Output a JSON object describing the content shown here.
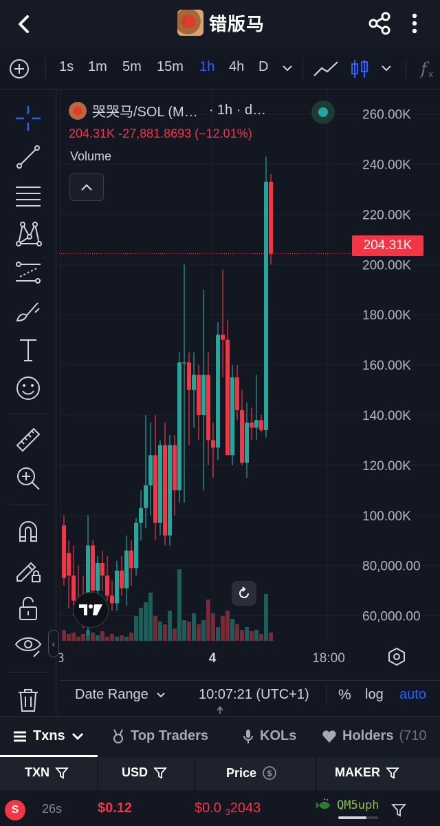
{
  "header": {
    "title": "错版马",
    "back_icon": "chevron-left-icon",
    "share_icon": "share-icon",
    "more_icon": "more-vertical-icon"
  },
  "toolbar": {
    "intervals": [
      {
        "label": "1s",
        "active": false
      },
      {
        "label": "1m",
        "active": false
      },
      {
        "label": "5m",
        "active": false
      },
      {
        "label": "15m",
        "active": false
      },
      {
        "label": "1h",
        "active": true
      },
      {
        "label": "4h",
        "active": false
      },
      {
        "label": "D",
        "active": false
      }
    ]
  },
  "legend": {
    "symbol": "哭哭马/SOL (M…",
    "interval": "· 1h · d…",
    "ohlc": "204.31K  -27,881.8693 (−12.01%)",
    "volume_label": "Volume"
  },
  "last_price": "204.31K",
  "chart_data": {
    "type": "candlestick",
    "y_axis_labels": [
      "260.00K",
      "240.00K",
      "220.00K",
      "200.00K",
      "180.00K",
      "160.00K",
      "140.00K",
      "120.00K",
      "100.00K",
      "80,000.00",
      "60,000.00"
    ],
    "ylim": [
      50000,
      264000
    ],
    "x_axis_labels": [
      "3",
      "4",
      "18:00"
    ],
    "colors": {
      "up": "#26a69a",
      "down": "#f23645"
    },
    "candles": [
      {
        "o": 96000,
        "h": 100000,
        "l": 72000,
        "c": 75000
      },
      {
        "o": 85000,
        "h": 90000,
        "l": 63000,
        "c": 76000
      },
      {
        "o": 76000,
        "h": 88000,
        "l": 60000,
        "c": 66000
      },
      {
        "o": 66000,
        "h": 80000,
        "l": 58000,
        "c": 62000
      },
      {
        "o": 62000,
        "h": 76000,
        "l": 55000,
        "c": 58000
      },
      {
        "o": 58000,
        "h": 100000,
        "l": 52000,
        "c": 88000
      },
      {
        "o": 88000,
        "h": 90000,
        "l": 62000,
        "c": 70000
      },
      {
        "o": 70000,
        "h": 84000,
        "l": 62000,
        "c": 81000
      },
      {
        "o": 81000,
        "h": 86000,
        "l": 70000,
        "c": 76000
      },
      {
        "o": 76000,
        "h": 84000,
        "l": 66000,
        "c": 68000
      },
      {
        "o": 68000,
        "h": 74000,
        "l": 62000,
        "c": 65000
      },
      {
        "o": 65000,
        "h": 82000,
        "l": 62000,
        "c": 78000
      },
      {
        "o": 78000,
        "h": 84000,
        "l": 68000,
        "c": 71000
      },
      {
        "o": 71000,
        "h": 92000,
        "l": 64000,
        "c": 86000
      },
      {
        "o": 86000,
        "h": 90000,
        "l": 72000,
        "c": 79000
      },
      {
        "o": 79000,
        "h": 99000,
        "l": 76000,
        "c": 97000
      },
      {
        "o": 97000,
        "h": 110000,
        "l": 90000,
        "c": 103000
      },
      {
        "o": 103000,
        "h": 140000,
        "l": 95000,
        "c": 112000
      },
      {
        "o": 112000,
        "h": 137000,
        "l": 100000,
        "c": 124000
      },
      {
        "o": 124000,
        "h": 140000,
        "l": 90000,
        "c": 97000
      },
      {
        "o": 97000,
        "h": 130000,
        "l": 92000,
        "c": 128000
      },
      {
        "o": 128000,
        "h": 137000,
        "l": 88000,
        "c": 92000
      },
      {
        "o": 92000,
        "h": 132000,
        "l": 88000,
        "c": 128000
      },
      {
        "o": 128000,
        "h": 132000,
        "l": 100000,
        "c": 110000
      },
      {
        "o": 110000,
        "h": 165000,
        "l": 105000,
        "c": 161000
      },
      {
        "o": 161000,
        "h": 200000,
        "l": 105000,
        "c": 161000
      },
      {
        "o": 161000,
        "h": 165000,
        "l": 128000,
        "c": 150000
      },
      {
        "o": 150000,
        "h": 165000,
        "l": 135000,
        "c": 156000
      },
      {
        "o": 156000,
        "h": 160000,
        "l": 130000,
        "c": 140000
      },
      {
        "o": 140000,
        "h": 190000,
        "l": 110000,
        "c": 156000
      },
      {
        "o": 156000,
        "h": 165000,
        "l": 120000,
        "c": 130000
      },
      {
        "o": 130000,
        "h": 137000,
        "l": 115000,
        "c": 127000
      },
      {
        "o": 127000,
        "h": 177000,
        "l": 122000,
        "c": 172000
      },
      {
        "o": 172000,
        "h": 198000,
        "l": 155000,
        "c": 170000
      },
      {
        "o": 170000,
        "h": 178000,
        "l": 128000,
        "c": 124000
      },
      {
        "o": 124000,
        "h": 160000,
        "l": 120000,
        "c": 155000
      },
      {
        "o": 155000,
        "h": 160000,
        "l": 138000,
        "c": 142000
      },
      {
        "o": 142000,
        "h": 150000,
        "l": 120000,
        "c": 121000
      },
      {
        "o": 121000,
        "h": 145000,
        "l": 115000,
        "c": 137000
      },
      {
        "o": 137000,
        "h": 143000,
        "l": 130000,
        "c": 135000
      },
      {
        "o": 135000,
        "h": 156000,
        "l": 130000,
        "c": 138000
      },
      {
        "o": 138000,
        "h": 140000,
        "l": 133000,
        "c": 134000
      },
      {
        "o": 134000,
        "h": 243000,
        "l": 131000,
        "c": 233000
      },
      {
        "o": 233000,
        "h": 236000,
        "l": 200000,
        "c": 204310
      }
    ],
    "volumes": [
      8,
      5,
      6,
      3,
      5,
      8,
      6,
      4,
      7,
      3,
      5,
      3,
      4,
      3,
      6,
      18,
      24,
      28,
      35,
      18,
      14,
      12,
      22,
      9,
      52,
      15,
      14,
      20,
      12,
      15,
      30,
      20,
      10,
      18,
      22,
      16,
      12,
      8,
      10,
      7,
      8,
      5,
      34,
      6
    ],
    "volume_max": 120,
    "last_price": 204310
  },
  "chart_controls": {
    "tv_logo": "TradingView",
    "reset_icon": "rotate-icon",
    "settings_icon": "hexagon-gear-icon"
  },
  "bottom_bar": {
    "date_range": "Date Range",
    "time": "10:07:21 (UTC+1)",
    "percent": "%",
    "log": "log",
    "auto": "auto"
  },
  "tabs": [
    {
      "label": "Txns",
      "icon": "list-icon",
      "active": true
    },
    {
      "label": "Top Traders",
      "icon": "medal-icon",
      "active": false
    },
    {
      "label": "KOLs",
      "icon": "microphone-icon",
      "active": false
    },
    {
      "label": "Holders",
      "icon": "heart-icon",
      "count": "(710",
      "active": false
    }
  ],
  "table": {
    "columns": [
      "TXN",
      "USD",
      "Price",
      "MAKER"
    ],
    "rows": [
      {
        "type": "S",
        "age": "26s",
        "usd": "$0.12",
        "price_prefix": "$0.0",
        "price_sub": "3",
        "price_rest": "2043",
        "maker": "QM5uph",
        "maker_progress": 0.7
      }
    ]
  }
}
